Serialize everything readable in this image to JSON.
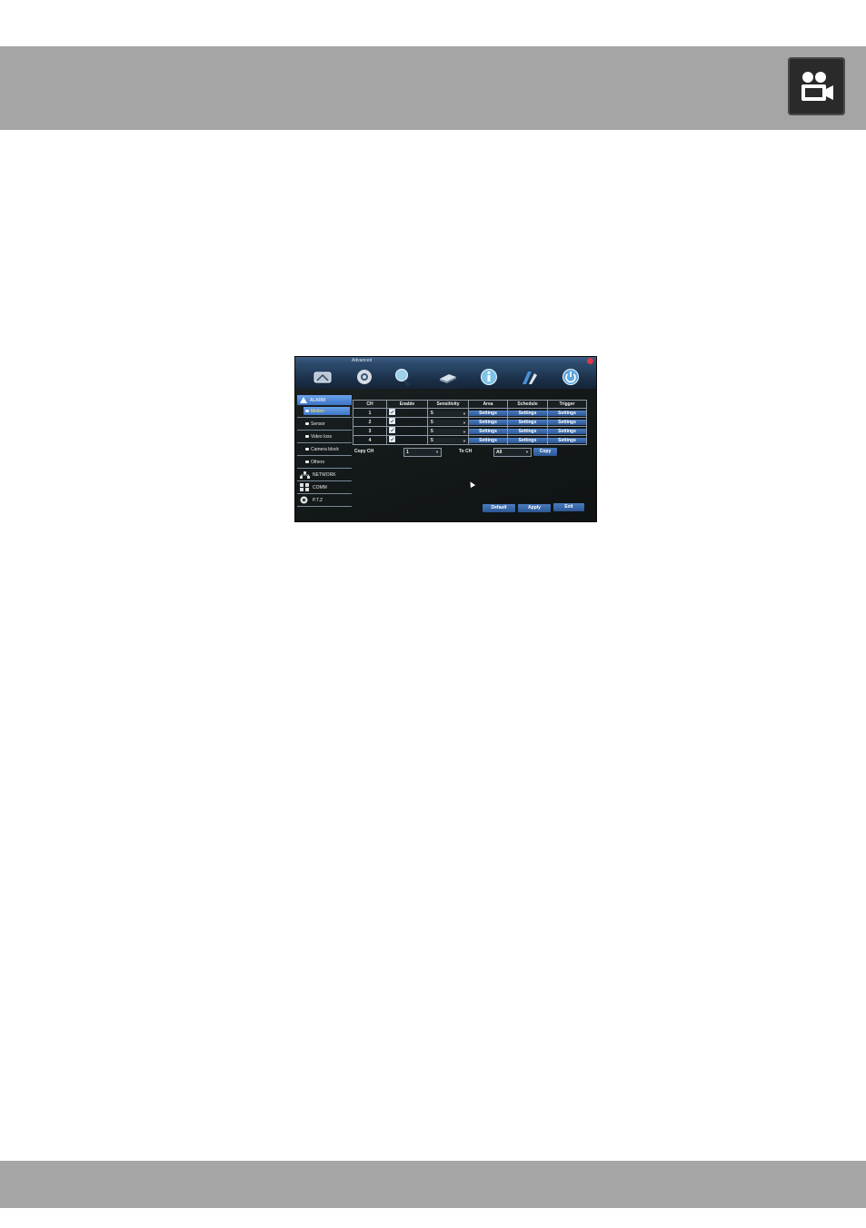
{
  "screen": {
    "title": "Advanced",
    "sidebar": [
      {
        "label": "ALARM",
        "type": "header"
      },
      {
        "label": "Motion",
        "type": "sub",
        "active": true
      },
      {
        "label": "Sensor",
        "type": "sub"
      },
      {
        "label": "Video loss",
        "type": "sub"
      },
      {
        "label": "Camera block",
        "type": "sub"
      },
      {
        "label": "Others",
        "type": "sub"
      },
      {
        "label": "NETWORK",
        "type": "section"
      },
      {
        "label": "COMM",
        "type": "section"
      },
      {
        "label": "P.T.Z",
        "type": "section"
      }
    ],
    "table": {
      "headers": [
        "CH",
        "Enable",
        "Sensitivity",
        "Area",
        "Schedule",
        "Trigger"
      ],
      "rows": [
        {
          "ch": "1",
          "sensitivity": "5",
          "area": "Settings",
          "schedule": "Settings",
          "trigger": "Settings"
        },
        {
          "ch": "2",
          "sensitivity": "5",
          "area": "Settings",
          "schedule": "Settings",
          "trigger": "Settings"
        },
        {
          "ch": "3",
          "sensitivity": "5",
          "area": "Settings",
          "schedule": "Settings",
          "trigger": "Settings"
        },
        {
          "ch": "4",
          "sensitivity": "5",
          "area": "Settings",
          "schedule": "Settings",
          "trigger": "Settings"
        }
      ]
    },
    "copy": {
      "from_label": "Copy CH",
      "from_value": "1",
      "to_label": "To CH",
      "to_value": "All",
      "button": "Copy"
    },
    "buttons": {
      "default": "Default",
      "apply": "Apply",
      "exit": "Exit"
    }
  }
}
